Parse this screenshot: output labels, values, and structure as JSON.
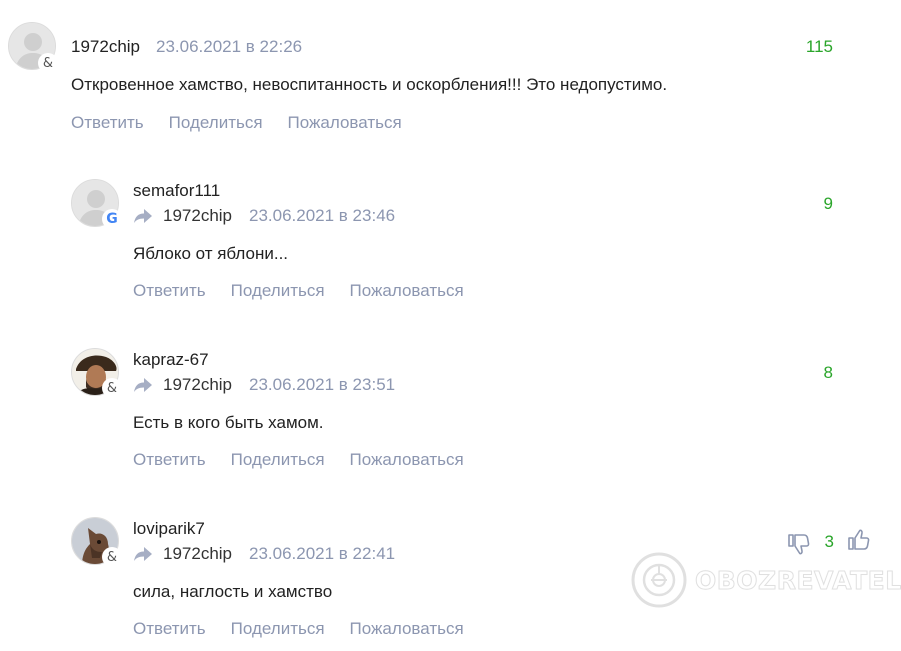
{
  "actions": {
    "reply": "Ответить",
    "share": "Поделиться",
    "report": "Пожаловаться"
  },
  "comments": [
    {
      "username": "1972chip",
      "date": "23.06.2021 в 22:26",
      "text": "Откровенное хамство, невоспитанность и оскорбления!!! Это недопустимо.",
      "rating": "115",
      "badge": "&",
      "avatar": "default-avatar"
    },
    {
      "username": "semafor111",
      "reply_to": "1972chip",
      "date": "23.06.2021 в 23:46",
      "text": "Яблоко от яблони...",
      "rating": "9",
      "badge": "G",
      "avatar": "default-avatar"
    },
    {
      "username": "kapraz-67",
      "reply_to": "1972chip",
      "date": "23.06.2021 в 23:51",
      "text": "Есть в кого быть хамом.",
      "rating": "8",
      "badge": "&",
      "avatar": "photo-avatar"
    },
    {
      "username": "loviparik7",
      "reply_to": "1972chip",
      "date": "23.06.2021 в 22:41",
      "text": "сила, наглость и хамство",
      "rating": "3",
      "badge": "&",
      "avatar": "photo-avatar"
    }
  ],
  "watermark": {
    "text": "OBOZREVATEL"
  },
  "colors": {
    "rating": "#2aa52a",
    "meta": "#8c96b0",
    "text": "#222222"
  }
}
